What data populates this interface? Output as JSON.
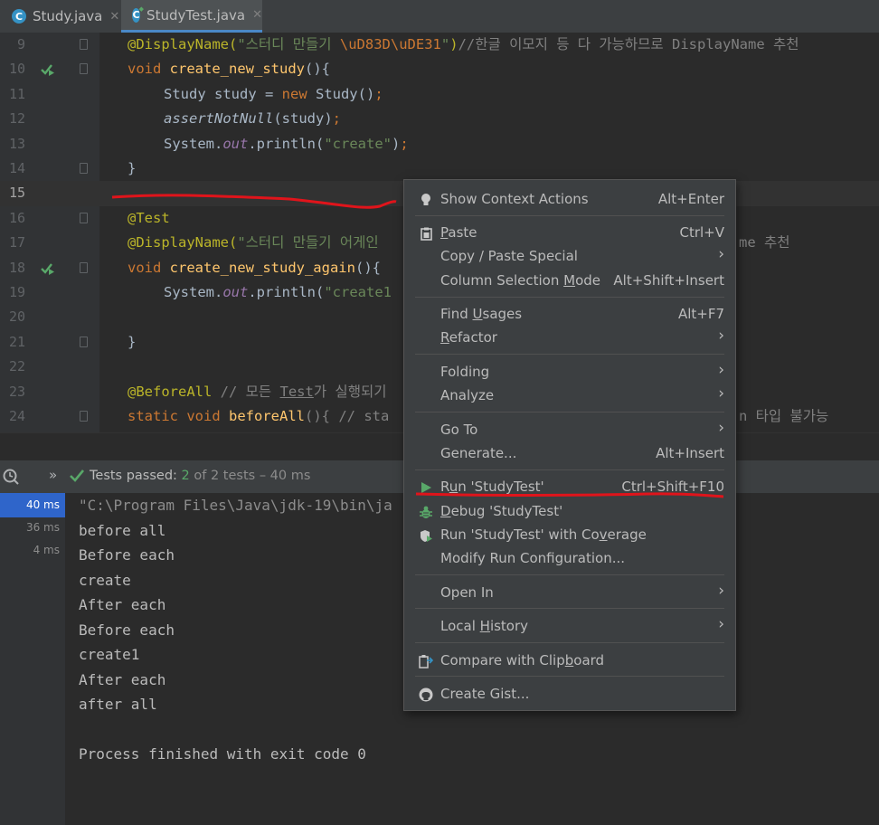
{
  "tabs": [
    {
      "label": "Study.java",
      "icon": "java-class-icon"
    },
    {
      "label": "StudyTest.java",
      "icon": "java-test-class-icon"
    }
  ],
  "editor": {
    "line_numbers": [
      "9",
      "10",
      "11",
      "12",
      "13",
      "14",
      "15",
      "16",
      "17",
      "18",
      "19",
      "20",
      "21",
      "22",
      "23",
      "24"
    ],
    "code": {
      "l9a": "@DisplayName(",
      "l9b": "\"스터디 만들기 ",
      "l9c": "\\uD83D\\uDE31",
      "l9d": "\"",
      "l9e": ")",
      "l9f": "//한글 이모지 등 다 가능하므로 DisplayName 추천",
      "l10a": "void ",
      "l10b": "create_new_study",
      "l10c": "(){",
      "l11a": "Study study = ",
      "l11b": "new ",
      "l11c": "Study()",
      "l11d": ";",
      "l12a": "assertNotNull",
      "l12b": "(study)",
      "l12c": ";",
      "l13a": "System.",
      "l13b": "out",
      "l13c": ".println(",
      "l13d": "\"create\"",
      "l13e": ")",
      "l13f": ";",
      "l14": "}",
      "l16": "@Test",
      "l17a": "@DisplayName(",
      "l17b": "\"스터디 만들기 어게인",
      "l17c": "me 추천",
      "l18a": "void ",
      "l18b": "create_new_study_again",
      "l18c": "(){",
      "l19a": "System.",
      "l19b": "out",
      "l19c": ".println(",
      "l19d": "\"create1",
      "l21": "}",
      "l23a": "@BeforeAll",
      "l23b": " // 모든 ",
      "l23c": "Test",
      "l23d": "가 실행되기",
      "l24a": "static ",
      "l24b": "void ",
      "l24c": "beforeAll",
      "l24d": "(){ // sta",
      "l24e": "n 타입 불가능"
    }
  },
  "run_panel": {
    "status_prefix": "Tests passed: ",
    "passed": "2",
    "status_suffix": " of 2 tests – 40 ms",
    "expand_glyph": "»",
    "times": [
      "40 ms",
      "36 ms",
      "4 ms"
    ],
    "output": [
      "\"C:\\Program Files\\Java\\jdk-19\\bin\\ja",
      "before all",
      "Before each",
      "create",
      "After each",
      "Before each",
      "create1",
      "After each",
      "after all",
      "",
      "Process finished with exit code 0"
    ]
  },
  "context_menu": {
    "items": [
      {
        "label": "Show Context Actions",
        "shortcut": "Alt+Enter",
        "icon": "lightbulb-icon"
      },
      {
        "label_pre": "",
        "label_u": "P",
        "label_post": "aste",
        "shortcut": "Ctrl+V",
        "icon": "clipboard-icon"
      },
      {
        "label": "Copy / Paste Special",
        "submenu": "›"
      },
      {
        "label_pre": "Column Selection ",
        "label_u": "M",
        "label_post": "ode",
        "shortcut": "Alt+Shift+Insert"
      },
      {
        "label_pre": "Find ",
        "label_u": "U",
        "label_post": "sages",
        "shortcut": "Alt+F7"
      },
      {
        "label_pre": "",
        "label_u": "R",
        "label_post": "efactor",
        "submenu": "›"
      },
      {
        "label": "Folding",
        "submenu": "›"
      },
      {
        "label": "Analyze",
        "submenu": "›"
      },
      {
        "label": "Go To",
        "submenu": "›"
      },
      {
        "label": "Generate...",
        "shortcut": "Alt+Insert"
      },
      {
        "label_pre": "R",
        "label_u": "u",
        "label_post": "n 'StudyTest'",
        "shortcut": "Ctrl+Shift+F10",
        "icon": "run-icon"
      },
      {
        "label_pre": "",
        "label_u": "D",
        "label_post": "ebug 'StudyTest'",
        "icon": "debug-icon"
      },
      {
        "label_pre": "Run 'StudyTest' with Co",
        "label_u": "v",
        "label_post": "erage",
        "icon": "coverage-icon"
      },
      {
        "label": "Modify Run Configuration..."
      },
      {
        "label": "Open In",
        "submenu": "›"
      },
      {
        "label_pre": "Local ",
        "label_u": "H",
        "label_post": "istory",
        "submenu": "›"
      },
      {
        "label_pre": "Compare with Clip",
        "label_u": "b",
        "label_post": "oard",
        "icon": "compare-icon"
      },
      {
        "label": "Create Gist...",
        "icon": "github-icon"
      }
    ]
  },
  "colors": {
    "accent": "#2f65ca",
    "annotation_red": "#e0141b",
    "pass_green": "#59a869"
  }
}
